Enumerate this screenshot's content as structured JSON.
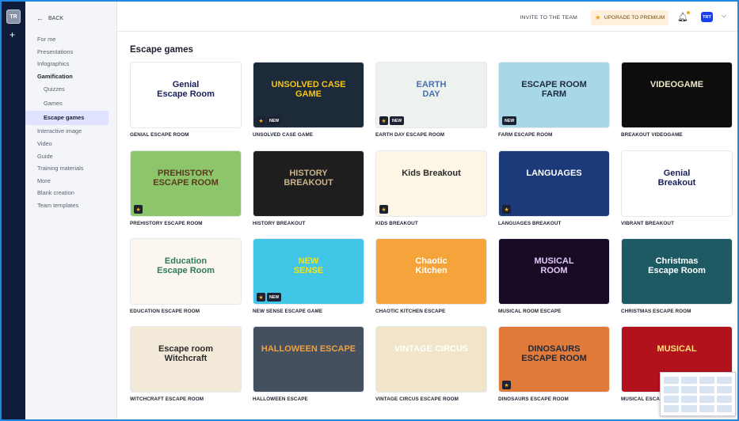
{
  "rail": {
    "avatar": "TR",
    "plus": "+"
  },
  "sidebar": {
    "back_label": "BACK",
    "items": [
      {
        "label": "For me",
        "type": "item"
      },
      {
        "label": "Presentations",
        "type": "item"
      },
      {
        "label": "Infographics",
        "type": "item"
      },
      {
        "label": "Gamification",
        "type": "bold"
      },
      {
        "label": "Quizzes",
        "type": "sub"
      },
      {
        "label": "Games",
        "type": "sub"
      },
      {
        "label": "Escape games",
        "type": "active"
      },
      {
        "label": "Interactive image",
        "type": "item"
      },
      {
        "label": "Video",
        "type": "item"
      },
      {
        "label": "Guide",
        "type": "item"
      },
      {
        "label": "Training materials",
        "type": "item"
      },
      {
        "label": "More",
        "type": "item"
      },
      {
        "label": "Blank creation",
        "type": "item"
      },
      {
        "label": "Team templates",
        "type": "item"
      }
    ]
  },
  "topbar": {
    "invite": "INVITE TO THE TEAM",
    "upgrade": "UPGRADE TO PREMIUM",
    "user_initials": "TRT"
  },
  "main": {
    "title": "Escape games",
    "cards": [
      {
        "title": "GENIAL ESCAPE ROOM",
        "badges": [],
        "bg": "#ffffff",
        "text": "Genial\nEscape Room",
        "text_color": "#1a1f5c"
      },
      {
        "title": "UNSOLVED CASE GAME",
        "badges": [
          "star",
          "new"
        ],
        "bg": "#1d2a3a",
        "text": "UNSOLVED CASE GAME",
        "text_color": "#f5c518"
      },
      {
        "title": "EARTH DAY ESCAPE ROOM",
        "badges": [
          "star",
          "new"
        ],
        "bg": "#eef2ef",
        "text": "EARTH\nDAY",
        "text_color": "#4a6fb0"
      },
      {
        "title": "FARM ESCAPE ROOM",
        "badges": [
          "new"
        ],
        "bg": "#a8d8e8",
        "text": "ESCAPE ROOM\nFARM",
        "text_color": "#1d2a3a"
      },
      {
        "title": "BREAKOUT VIDEOGAME",
        "badges": [],
        "bg": "#0d0d0d",
        "text": "VIDEOGAME",
        "text_color": "#f0e6c8"
      },
      {
        "title": "PREHISTORY ESCAPE ROOM",
        "badges": [
          "star"
        ],
        "bg": "#8cc56b",
        "text": "PREHISTORY\nESCAPE ROOM",
        "text_color": "#5a3a1d"
      },
      {
        "title": "HISTORY BREAKOUT",
        "badges": [],
        "bg": "#1e1e1e",
        "text": "HISTORY\nBREAKOUT",
        "text_color": "#c9b48a"
      },
      {
        "title": "KIDS BREAKOUT",
        "badges": [
          "star"
        ],
        "bg": "#fdf6e7",
        "text": "Kids Breakout",
        "text_color": "#2b2b2b"
      },
      {
        "title": "LANGUAGES BREAKOUT",
        "badges": [
          "star"
        ],
        "bg": "#1c3a7a",
        "text": "LANGUAGES",
        "text_color": "#ffffff"
      },
      {
        "title": "VIBRANT BREAKOUT",
        "badges": [],
        "bg": "#ffffff",
        "text": "Genial\nBreakout",
        "text_color": "#1a1f5c"
      },
      {
        "title": "EDUCATION ESCAPE ROOM",
        "badges": [],
        "bg": "#fbf7ef",
        "text": "Education\nEscape Room",
        "text_color": "#2d7a5e"
      },
      {
        "title": "NEW SENSE ESCAPE GAME",
        "badges": [
          "star",
          "new"
        ],
        "bg": "#41c6e8",
        "text": "NEW\nSENSE",
        "text_color": "#f5e21a"
      },
      {
        "title": "CHAOTIC KITCHEN ESCAPE",
        "badges": [],
        "bg": "#f4a43a",
        "text": "Chaotic\nKitchen",
        "text_color": "#ffffff"
      },
      {
        "title": "MUSICAL ROOM ESCAPE",
        "badges": [],
        "bg": "#160a25",
        "text": "MUSICAL\nROOM",
        "text_color": "#e3c8f7"
      },
      {
        "title": "CHRISTMAS ESCAPE ROOM",
        "badges": [],
        "bg": "#1d5a63",
        "text": "Christmas\nEscape Room",
        "text_color": "#ffffff"
      },
      {
        "title": "WITCHCRAFT ESCAPE ROOM",
        "badges": [],
        "bg": "#f3e9d9",
        "text": "Escape room\nWitchcraft",
        "text_color": "#2b2b2b"
      },
      {
        "title": "HALLOWEEN ESCAPE",
        "badges": [],
        "bg": "#44505e",
        "text": "HALLOWEEN ESCAPE",
        "text_color": "#f0a040"
      },
      {
        "title": "VINTAGE CIRCUS ESCAPE ROOM",
        "badges": [],
        "bg": "#f2e4c8",
        "text": "VINTAGE CIRCUS",
        "text_color": "#ffffff"
      },
      {
        "title": "DINOSAURS ESCAPE ROOM",
        "badges": [
          "star"
        ],
        "bg": "#e07a3a",
        "text": "DINOSAURS\nESCAPE ROOM",
        "text_color": "#1d2a3a"
      },
      {
        "title": "MUSICAL ESCAP",
        "badges": [],
        "bg": "#b1121c",
        "text": "MUSICAL",
        "text_color": "#fbe37a"
      }
    ]
  },
  "colors": {
    "accent": "#1a3ff3",
    "sidebar_active": "#dfe3ff",
    "rail": "#0f1c3a",
    "upgrade_bg": "#fff0dc"
  }
}
